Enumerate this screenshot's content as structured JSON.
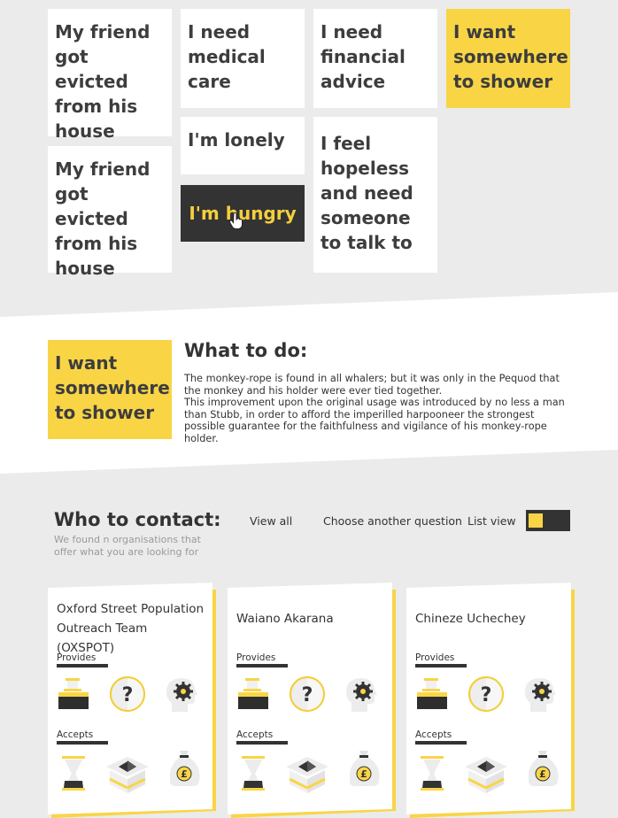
{
  "questions": {
    "col1": [
      "My friend got evicted from his house",
      "My friend got evicted from his house"
    ],
    "col2": [
      "I need medical care",
      "I'm lonely",
      "I'm hungry"
    ],
    "col3": [
      "I need financial advice",
      "I feel hopeless and need someone to talk to"
    ],
    "col4": [
      "I want somewhere to shower"
    ]
  },
  "answer": {
    "tile": "I want somewhere to shower",
    "heading": "What to do:",
    "body": "The monkey-rope is found in all whalers; but it was only in the Pequod that the monkey and his holder were ever tied together.\nThis improvement upon the original usage was introduced by no less a man than Stubb, in order to afford the imperilled harpooneer the strongest possible guarantee for the faithfulness and vigilance of his monkey-rope holder."
  },
  "contact": {
    "heading": "Who to contact:",
    "subtitle": "We found n organisations that offer what you are looking for",
    "view_all": "View all",
    "choose_another": "Choose another question",
    "list_view": "List view"
  },
  "cards": [
    {
      "name": "Oxford Street Population Outreach Team (OXSPOT)",
      "provides": "Provides",
      "accepts": "Accepts"
    },
    {
      "name": "Waiano Akarana",
      "provides": "Provides",
      "accepts": "Accepts"
    },
    {
      "name": "Chineze Uchechey",
      "provides": "Provides",
      "accepts": "Accepts"
    }
  ],
  "icons": {
    "provides": [
      "washbasin-icon",
      "question-icon",
      "head-gear-icon"
    ],
    "accepts": [
      "hourglass-icon",
      "box-icon",
      "money-bag-icon"
    ]
  },
  "colors": {
    "accent": "#f9d546",
    "dark": "#333333",
    "background": "#ebebeb"
  }
}
